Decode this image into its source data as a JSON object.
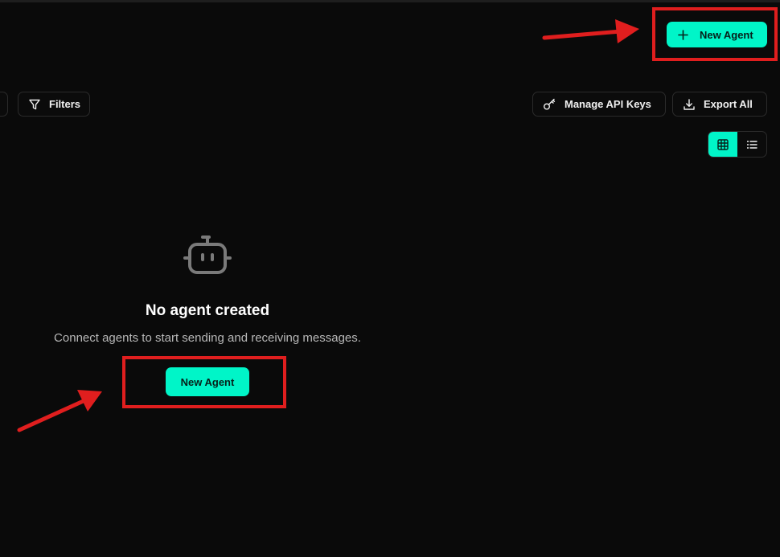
{
  "header": {
    "new_agent_label": "New Agent"
  },
  "toolbar": {
    "filters_label": "Filters",
    "manage_api_keys_label": "Manage API Keys",
    "export_all_label": "Export All"
  },
  "view_toggle": {
    "options": [
      "grid",
      "list"
    ],
    "selected": "grid"
  },
  "empty_state": {
    "title": "No agent created",
    "subtitle": "Connect agents to start sending and receiving messages.",
    "button_label": "New Agent"
  },
  "icons": {
    "plus": "plus-icon",
    "filter": "filter-icon",
    "key": "key-icon",
    "download": "download-icon",
    "grid": "grid-icon",
    "list": "list-icon",
    "robot": "robot-icon"
  },
  "colors": {
    "background": "#0a0a0a",
    "accent": "#00f5c8",
    "annotation": "#e01e1e"
  }
}
